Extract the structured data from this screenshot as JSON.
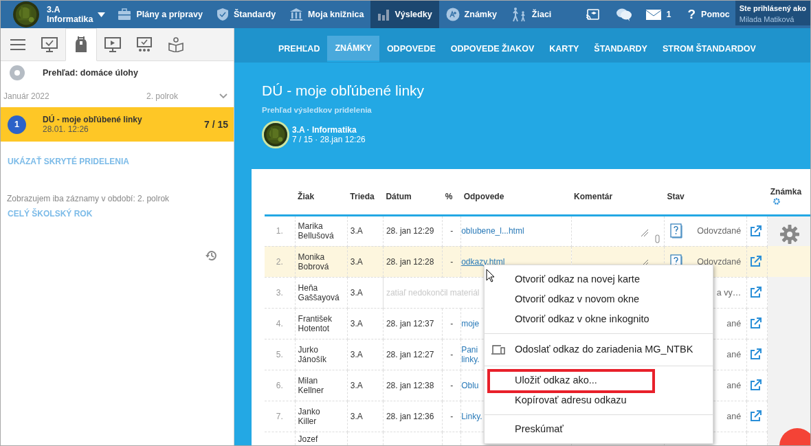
{
  "top_nav": {
    "class_name": "3.A",
    "subject": "Informatika",
    "items": [
      {
        "kind": "briefcase",
        "label": "Plány a prípravy",
        "selected": false
      },
      {
        "kind": "shield",
        "label": "Štandardy",
        "selected": false
      },
      {
        "kind": "library",
        "label": "Moja knižnica",
        "selected": false
      },
      {
        "kind": "chart",
        "label": "Výsledky",
        "selected": true
      },
      {
        "kind": "grade",
        "label": "Známky",
        "selected": false
      },
      {
        "kind": "pupils",
        "label": "Žiaci",
        "selected": false
      }
    ],
    "mail_count": "1",
    "help_glyph": "?",
    "help_label": "Pomoc",
    "login_caption": "Ste prihlásený ako",
    "login_user": "Milada Matiková"
  },
  "sidebar": {
    "tabs": [
      {
        "kind": "menu",
        "selected": false
      },
      {
        "kind": "monitor-check",
        "selected": false
      },
      {
        "kind": "backpack",
        "selected": true
      },
      {
        "kind": "play",
        "selected": false
      },
      {
        "kind": "monitor-dots",
        "selected": false
      },
      {
        "kind": "book",
        "selected": false
      }
    ],
    "overview_title": "Prehľad: domáce úlohy",
    "month": "Január 2022",
    "period": "2. polrok",
    "assignments": [
      {
        "number": "1",
        "title": "DÚ - moje obľúbené linky",
        "date": "28.01. 12:26",
        "score": "7 / 15",
        "selected": true
      }
    ],
    "show_hidden": "UKÁZAŤ SKRYTÉ PRIDELENIA",
    "filter_note": "Zobrazujem iba záznamy v období: 2. polrok",
    "whole_year": "CELÝ ŠKOLSKÝ ROK"
  },
  "subnav": [
    {
      "label": "PREHĽAD",
      "selected": false
    },
    {
      "label": "ZNÁMKY",
      "selected": true
    },
    {
      "label": "ODPOVEDE",
      "selected": false
    },
    {
      "label": "ODPOVEDE ŽIAKOV",
      "selected": false
    },
    {
      "label": "KARTY",
      "selected": false
    },
    {
      "label": "ŠTANDARDY",
      "selected": false
    },
    {
      "label": "STROM ŠTANDARDOV",
      "selected": false
    }
  ],
  "header": {
    "title": "DÚ - moje obľúbené linky",
    "subtitle": "Prehľad výsledkov pridelenia",
    "class_line": "3.A · Informatika",
    "meta": "7 / 15 · 28.jan 12:26"
  },
  "table": {
    "columns": [
      "Žiak",
      "Trieda",
      "Dátum",
      "%",
      "Odpovede",
      "Komentár",
      "Stav",
      "Známka"
    ],
    "rows": [
      {
        "kind": "submitted",
        "number": "1.",
        "name": "Marika Bellušová",
        "class": "3.A",
        "date": "28. jan 12:29",
        "percent": "-",
        "answer": "oblubene_l...html",
        "comment_edit": true,
        "attachment": true,
        "status_icon": true,
        "status": "Odovzdané",
        "selected": false
      },
      {
        "kind": "submitted",
        "number": "2.",
        "name": "Monika Bobrová",
        "class": "3.A",
        "date": "28. jan 12:28",
        "percent": "-",
        "answer": "odkazy.html",
        "comment_edit": true,
        "attachment": false,
        "status_icon": true,
        "status": "Odovzdané",
        "selected": true
      },
      {
        "kind": "unfinished",
        "number": "3.",
        "name": "Heňa Gaššayová",
        "class": "3.A",
        "note": "zatiaľ nedokončil materiál",
        "status": "a vy…",
        "selected": false
      },
      {
        "kind": "submitted",
        "number": "4.",
        "name": "František Hotentot",
        "class": "3.A",
        "date": "28. jan 12:37",
        "percent": "-",
        "answer": "moje",
        "status": "ané",
        "selected": false
      },
      {
        "kind": "submitted",
        "number": "5.",
        "name": "Jurko Jánošík",
        "class": "3.A",
        "date": "28. jan 12:27",
        "percent": "-",
        "answer": "Pani\nlinky.",
        "status": "ané",
        "selected": false
      },
      {
        "kind": "submitted",
        "number": "6.",
        "name": "Milan Kellner",
        "class": "3.A",
        "date": "28. jan 12:38",
        "percent": "-",
        "answer": "Oblu",
        "status": "ané",
        "selected": false
      },
      {
        "kind": "submitted",
        "number": "7.",
        "name": "Janko Killer",
        "class": "3.A",
        "date": "28. jan 12:36",
        "percent": "-",
        "answer": "Linky.",
        "status": "ané",
        "selected": false
      },
      {
        "kind": "partial",
        "name": "Jozef"
      }
    ]
  },
  "context_menu": {
    "groups": [
      [
        {
          "kind": "plain",
          "label": "Otvoriť odkaz na novej karte",
          "highlighted": false
        },
        {
          "kind": "plain",
          "label": "Otvoriť odkaz v novom okne",
          "highlighted": false
        },
        {
          "kind": "plain",
          "label": "Otvoriť odkaz v okne inkognito",
          "highlighted": false
        }
      ],
      [
        {
          "kind": "device",
          "label": "Odoslať odkaz do zariadenia MG_NTBK",
          "highlighted": false
        }
      ],
      [
        {
          "kind": "plain",
          "label": "Uložiť odkaz ako...",
          "highlighted": true
        },
        {
          "kind": "plain",
          "label": "Kopírovať adresu odkazu",
          "highlighted": false
        }
      ],
      [
        {
          "kind": "plain",
          "label": "Preskúmať",
          "highlighted": false
        }
      ]
    ]
  }
}
